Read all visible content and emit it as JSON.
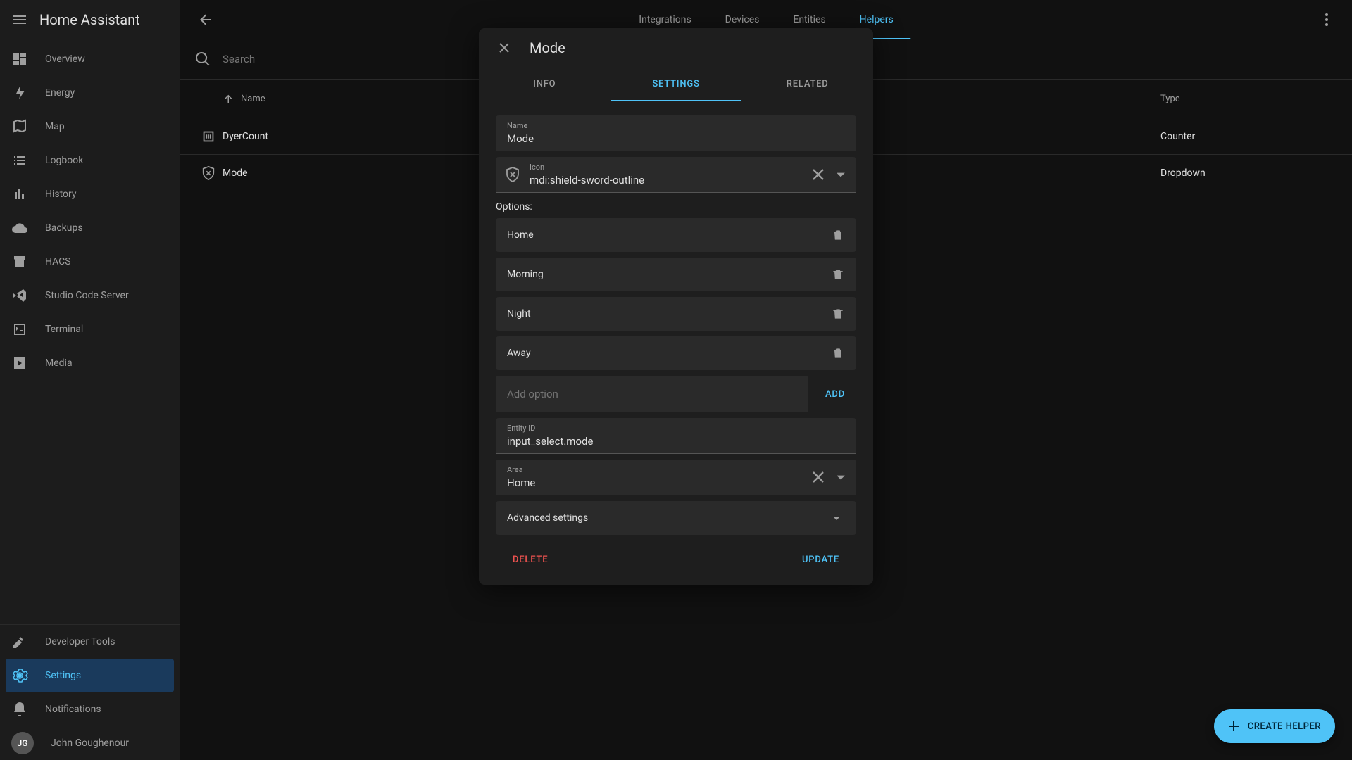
{
  "app": {
    "title": "Home Assistant"
  },
  "sidebar": {
    "items": [
      {
        "label": "Overview",
        "icon": "dashboard"
      },
      {
        "label": "Energy",
        "icon": "bolt"
      },
      {
        "label": "Map",
        "icon": "map"
      },
      {
        "label": "Logbook",
        "icon": "list"
      },
      {
        "label": "History",
        "icon": "chart"
      },
      {
        "label": "Backups",
        "icon": "cloud"
      },
      {
        "label": "HACS",
        "icon": "store"
      },
      {
        "label": "Studio Code Server",
        "icon": "code"
      },
      {
        "label": "Terminal",
        "icon": "terminal"
      },
      {
        "label": "Media",
        "icon": "play"
      }
    ],
    "bottom": {
      "developer": "Developer Tools",
      "settings": "Settings",
      "notifications": "Notifications",
      "user_name": "John Goughenour",
      "user_initials": "JG"
    }
  },
  "top_tabs": [
    {
      "label": "Integrations",
      "active": false
    },
    {
      "label": "Devices",
      "active": false
    },
    {
      "label": "Entities",
      "active": false
    },
    {
      "label": "Helpers",
      "active": true
    }
  ],
  "search": {
    "placeholder": "Search"
  },
  "table": {
    "columns": {
      "name": "Name",
      "type": "Type"
    },
    "rows": [
      {
        "name": "DyerCount",
        "type": "Counter",
        "icon": "counter"
      },
      {
        "name": "Mode",
        "type": "Dropdown",
        "icon": "shield"
      }
    ]
  },
  "fab": {
    "label": "CREATE HELPER"
  },
  "dialog": {
    "title": "Mode",
    "tabs": {
      "info": "INFO",
      "settings": "SETTINGS",
      "related": "RELATED"
    },
    "name_field": {
      "label": "Name",
      "value": "Mode"
    },
    "icon_field": {
      "label": "Icon",
      "value": "mdi:shield-sword-outline"
    },
    "options_label": "Options:",
    "options": [
      "Home",
      "Morning",
      "Night",
      "Away"
    ],
    "add_option": {
      "placeholder": "Add option",
      "button": "ADD"
    },
    "entity_field": {
      "label": "Entity ID",
      "value": "input_select.mode"
    },
    "area_field": {
      "label": "Area",
      "value": "Home"
    },
    "advanced": "Advanced settings",
    "actions": {
      "delete": "DELETE",
      "update": "UPDATE"
    }
  },
  "colors": {
    "accent": "#4fc3f7",
    "danger": "#ef5350"
  }
}
